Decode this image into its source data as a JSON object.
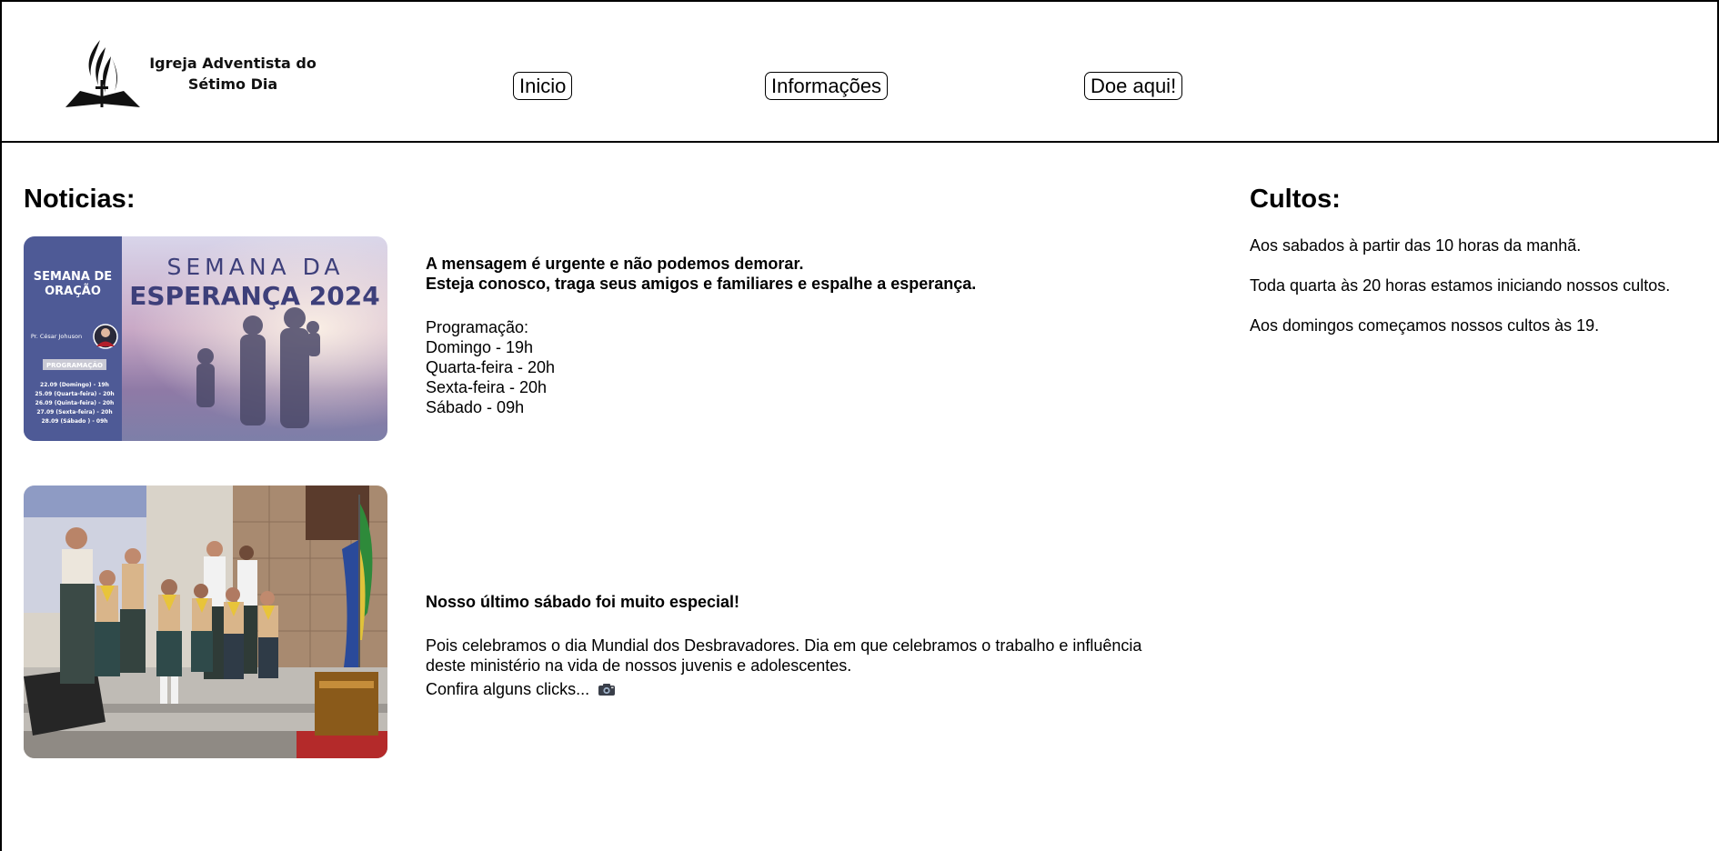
{
  "header": {
    "brand_line1": "Igreja Adventista do",
    "brand_line2": "Sétimo Dia",
    "nav": {
      "inicio": "Inicio",
      "informacoes": "Informações",
      "doe": "Doe aqui!"
    }
  },
  "noticias": {
    "title": "Noticias:",
    "items": [
      {
        "headline_line1": "A mensagem é urgente e não podemos demorar.",
        "headline_line2": "Esteja conosco, traga seus amigos e familiares e espalhe a esperança.",
        "body_lines": [
          "Programação:",
          "Domingo - 19h",
          "Quarta-feira - 20h",
          "Sexta-feira - 20h",
          "Sábado - 09h"
        ],
        "image": {
          "side_title_line1": "SEMANA DE",
          "side_title_line2": "ORAÇÃO",
          "speaker": "Pr. César Johuson",
          "tag": "PROGRAMAÇÃO",
          "schedule": [
            "22.09 (Domingo) - 19h",
            "25.09 (Quarta-feira) - 20h",
            "26.09 (Quinta-feira) - 20h",
            "27.09 (Sexta-feira) - 20h",
            "28.09 (Sábado ) - 09h"
          ],
          "main_line1": "SEMANA DA",
          "main_line2": "ESPERANÇA 2024"
        }
      },
      {
        "headline": "Nosso último sábado foi muito especial!",
        "body_line1": "Pois celebramos o dia Mundial dos Desbravadores. Dia em que celebramos o trabalho e influência",
        "body_line2": "deste ministério na vida de nossos juvenis e adolescentes.",
        "link_text": "Confira alguns clicks...",
        "link_icon": "camera-icon"
      }
    ]
  },
  "cultos": {
    "title": "Cultos:",
    "lines": [
      "Aos sabados à partir das 10 horas da manhã.",
      "Toda quarta às 20 horas estamos iniciando nossos cultos.",
      "Aos domingos começamos nossos cultos às 19."
    ]
  },
  "colors": {
    "poster_sidebar": "#4e5a96",
    "poster_text": "#3d3f7a",
    "uniform_khaki": "#d9b58a",
    "scarf_yellow": "#e8c43a"
  }
}
